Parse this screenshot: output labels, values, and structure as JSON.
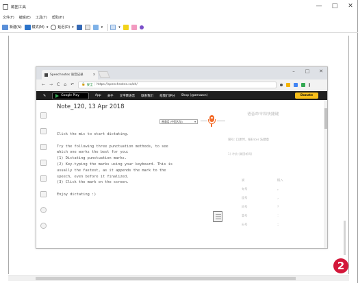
{
  "window": {
    "title": "截图工具",
    "controls": {
      "minimize": "—",
      "maximize": "□",
      "close": "✕"
    }
  },
  "menu": [
    "文件(F)",
    "编辑(E)",
    "工具(T)",
    "帮助(H)"
  ],
  "toolbar": {
    "new_label": "新建(N)",
    "mode_label": "模式(M)",
    "delay_label": "延迟(D)",
    "dropdown_arrow": "▾"
  },
  "badge": "2",
  "browser": {
    "tab_title": "Speechnotes 语音记录",
    "tab_close": "x",
    "controls": {
      "minimize": "–",
      "maximize": "□",
      "close": "✕"
    },
    "nav": {
      "back": "←",
      "forward": "→",
      "reload": "C",
      "home": "⌂",
      "extra": "↶"
    },
    "secure_label": "安全",
    "url": "https://speechnotes.co/zh/",
    "bar_items": [
      "App",
      "关于",
      "文字转语音",
      "联系我们",
      "给我们评分",
      "Shop (@amazon)"
    ],
    "google_play": "Google Play",
    "donate": "Donate",
    "note_title": "Note_120, 13 Apr 2018",
    "language": "普通话 (中国大陆)",
    "editor_lines": [
      "Click the mic to start dictating.",
      "",
      "Try the following three punctuation methods, to see",
      "which one works the best for you:",
      "(1) Dictating punctuation marks.",
      "(2) Key-typing the marks using your keyboard. This is",
      "usually the fastest, as it appends the mark to the",
      "speech, even before it finalized.",
      "(3) Click the mark on the screen.",
      "",
      "Enjoy dictating :)"
    ],
    "right_panel": {
      "title": "语音命令和快捷键",
      "line1": "冒号: 口述时，按Enter 法键意",
      "line2": "1) 冲浪 (美国新闻)",
      "table_header": [
        "说",
        "插入"
      ],
      "table_rows": [
        [
          "句号",
          "。"
        ],
        [
          "逗号",
          "，"
        ],
        [
          "问号",
          "？"
        ],
        [
          "冒号",
          "："
        ],
        [
          "分号",
          "；"
        ]
      ]
    }
  }
}
